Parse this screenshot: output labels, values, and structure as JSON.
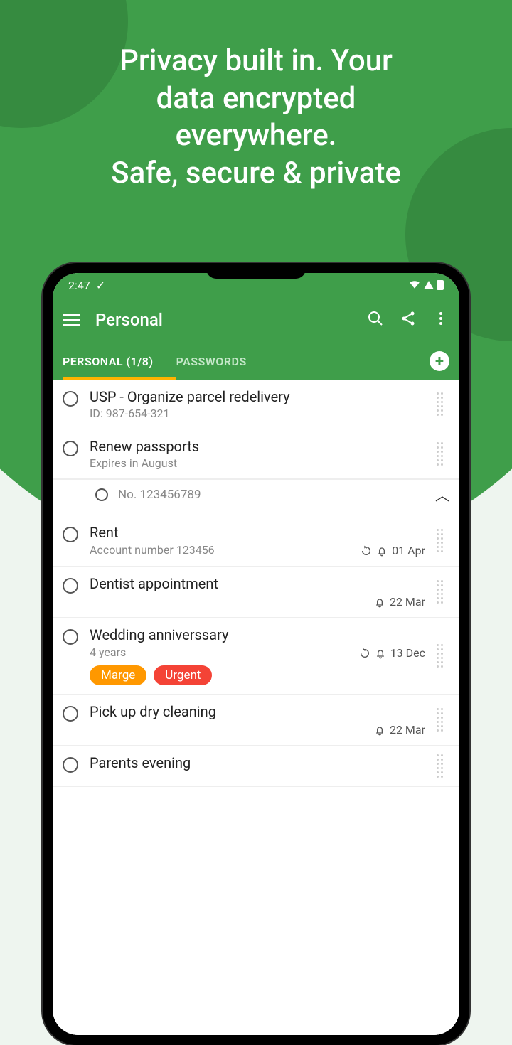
{
  "headline": "Privacy built in. Your\ndata encrypted\neverywhere.\nSafe, secure & private",
  "status": {
    "time": "2:47",
    "check": "✓"
  },
  "appbar": {
    "title": "Personal"
  },
  "tabs": {
    "personal": "PERSONAL (1/8)",
    "passwords": "PASSWORDS"
  },
  "items": [
    {
      "title": "USP - Organize parcel redelivery",
      "sub": "ID: 987-654-321"
    },
    {
      "title": "Renew passports",
      "sub": "Expires in August",
      "subtask": "No. 123456789"
    },
    {
      "title": "Rent",
      "sub": "Account number 123456",
      "refresh": true,
      "bell": true,
      "date": "01 Apr"
    },
    {
      "title": "Dentist appointment",
      "bell": true,
      "date": "22 Mar"
    },
    {
      "title": "Wedding anniverssary",
      "sub": "4 years",
      "refresh": true,
      "bell": true,
      "date": "13 Dec",
      "tags": [
        {
          "text": "Marge",
          "cls": "orange"
        },
        {
          "text": "Urgent",
          "cls": "red"
        }
      ]
    },
    {
      "title": "Pick up dry cleaning",
      "bell": true,
      "date": "22 Mar"
    },
    {
      "title": "Parents evening"
    }
  ]
}
